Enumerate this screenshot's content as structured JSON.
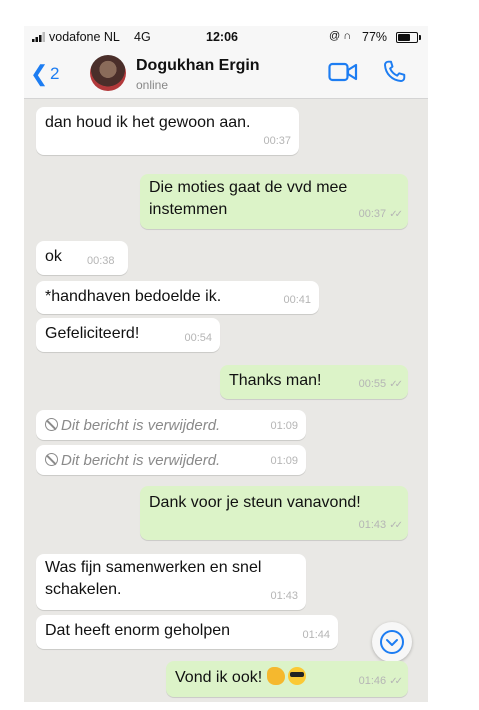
{
  "statusbar": {
    "carrier": "vodafone NL",
    "network": "4G",
    "time": "12:06",
    "icons": "@ ∩",
    "battery": "77%",
    "battery_level": 0.77
  },
  "header": {
    "back_count": "2",
    "contact_name": "Dogukhan Ergin",
    "contact_status": "online"
  },
  "messages": [
    {
      "dir": "in",
      "text": "dan houd ik het gewoon aan.",
      "time": "00:37"
    },
    {
      "dir": "out",
      "lines": [
        "Die moties gaat de vvd mee",
        "instemmen"
      ],
      "time": "00:37"
    },
    {
      "dir": "in",
      "text": "ok",
      "time": "00:38"
    },
    {
      "dir": "in",
      "text": "*handhaven bedoelde ik.",
      "time": "00:41"
    },
    {
      "dir": "in",
      "text": "Gefeliciteerd!",
      "time": "00:54"
    },
    {
      "dir": "out",
      "text": "Thanks man!",
      "time": "00:55"
    },
    {
      "dir": "in",
      "deleted": true,
      "text": "Dit bericht is verwijderd.",
      "time": "01:09"
    },
    {
      "dir": "in",
      "deleted": true,
      "text": "Dit bericht is verwijderd.",
      "time": "01:09"
    },
    {
      "dir": "out",
      "text": "Dank voor je steun vanavond!",
      "time": "01:43"
    },
    {
      "dir": "in",
      "lines": [
        "Was fijn samenwerken en snel",
        "schakelen."
      ],
      "time": "01:43"
    },
    {
      "dir": "in",
      "text": "Dat heeft enorm geholpen",
      "time": "01:44"
    },
    {
      "dir": "out",
      "text": "Vond ik ook!",
      "emoji": [
        "flexed-biceps-emoji",
        "smiling-face-with-sunglasses-emoji"
      ],
      "time": "01:46"
    }
  ],
  "colors": {
    "accent": "#1d7df2",
    "incoming_bubble": "#ffffff",
    "outgoing_bubble": "#dcf3c8",
    "chat_background": "#e9e8e5"
  }
}
